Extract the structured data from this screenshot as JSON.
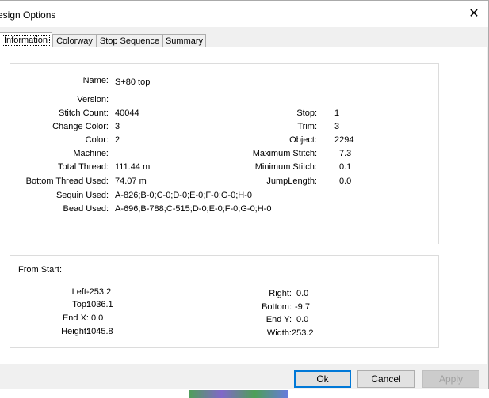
{
  "window": {
    "title": "esign Options",
    "close_glyph": "✕"
  },
  "tabs": [
    {
      "label": "Information",
      "active": true
    },
    {
      "label": "Colorway"
    },
    {
      "label": "Stop Sequence"
    },
    {
      "label": "Summary"
    }
  ],
  "info": {
    "name_label": "Name:",
    "name": "S+80 top",
    "version_label": "Version:",
    "version": "",
    "stitch_count_label": "Stitch Count:",
    "stitch_count": "40044",
    "change_color_label": "Change Color:",
    "change_color": "3",
    "color_label": "Color:",
    "color": "2",
    "machine_label": "Machine:",
    "machine": "",
    "total_thread_label": "Total Thread:",
    "total_thread": "111.44 m",
    "bottom_thread_label": "Bottom Thread Used:",
    "bottom_thread": "74.07 m",
    "sequin_label": "Sequin Used:",
    "sequin": "A-826;B-0;C-0;D-0;E-0;F-0;G-0;H-0",
    "bead_label": "Bead Used:",
    "bead": "A-696;B-788;C-515;D-0;E-0;F-0;G-0;H-0",
    "stop_label": "Stop:",
    "stop": "1",
    "trim_label": "Trim:",
    "trim": "3",
    "object_label": "Object:",
    "object": "2294",
    "max_stitch_label": "Maximum Stitch:",
    "max_stitch": "7.3",
    "min_stitch_label": "Minimum Stitch:",
    "min_stitch": "0.1",
    "jump_length_label": "JumpLength:",
    "jump_length": "0.0"
  },
  "from_start": {
    "heading": "From Start:",
    "left_label": "Left:",
    "left": "-253.2",
    "top_label": "Top:",
    "top": "1036.1",
    "endx_label": "End X:",
    "endx": "0.0",
    "height_label": "Height:",
    "height": "1045.8",
    "right_label": "Right:",
    "right": "0.0",
    "bottom_label": "Bottom:",
    "bottom": "-9.7",
    "endy_label": "End Y:",
    "endy": "0.0",
    "width_label": "Width:",
    "width": "253.2"
  },
  "buttons": {
    "ok": "Ok",
    "cancel": "Cancel",
    "apply": "Apply"
  },
  "colors": {
    "accent": "#0078d7",
    "dialog_bg": "#f0f0f0",
    "panel_bg": "#ffffff"
  }
}
